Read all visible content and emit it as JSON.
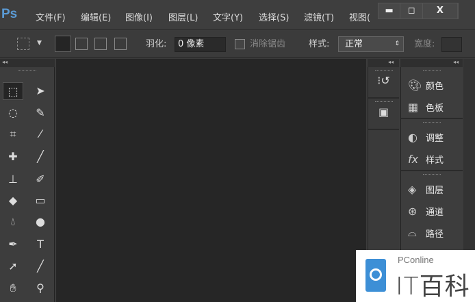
{
  "app": {
    "logo": "Ps"
  },
  "menu": [
    "文件(F)",
    "编辑(E)",
    "图像(I)",
    "图层(L)",
    "文字(Y)",
    "选择(S)",
    "滤镜(T)",
    "视图("
  ],
  "window": {
    "minimize": "▬",
    "maximize": "◻",
    "close": "X"
  },
  "options": {
    "feather_label": "羽化:",
    "feather_value": "0 像素",
    "antialias_label": "消除锯齿",
    "style_label": "样式:",
    "style_value": "正常",
    "width_label": "宽度:"
  },
  "collapse": "◂◂",
  "right_panel": {
    "groups": [
      [
        {
          "icon": "palette-icon",
          "label": "颜色"
        },
        {
          "icon": "swatches-icon",
          "label": "色板"
        }
      ],
      [
        {
          "icon": "adjustments-icon",
          "label": "调整"
        },
        {
          "icon": "styles-icon",
          "label": "样式"
        }
      ],
      [
        {
          "icon": "layers-icon",
          "label": "图层"
        },
        {
          "icon": "channels-icon",
          "label": "通道"
        },
        {
          "icon": "paths-icon",
          "label": "路径"
        }
      ]
    ]
  },
  "watermark": {
    "brand": "PConline",
    "name": "IT百科"
  }
}
